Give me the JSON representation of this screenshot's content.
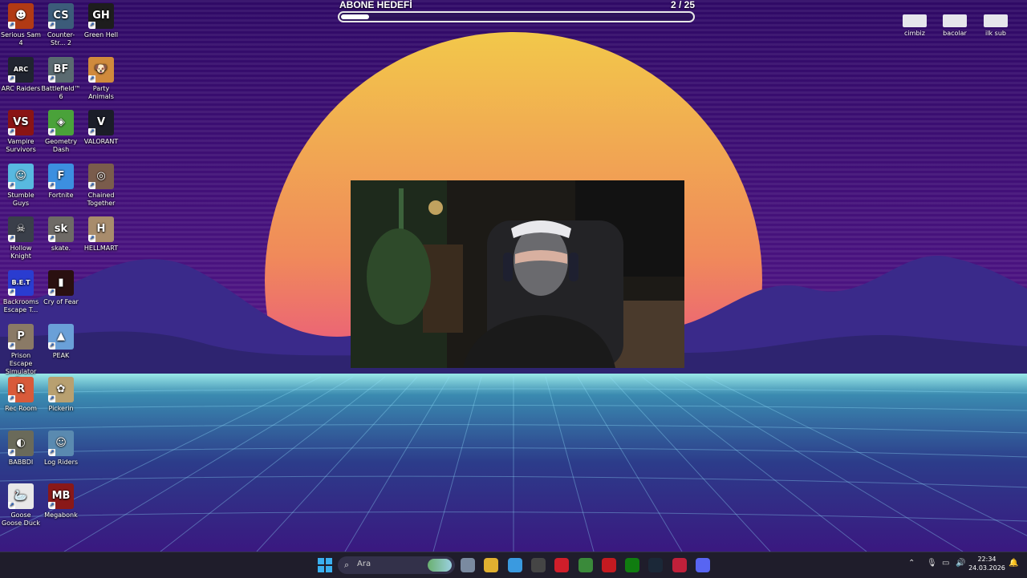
{
  "stream_overlay": {
    "goal_title": "ABONE HEDEFİ",
    "goal_count": "2  / 25",
    "goal_current": 2,
    "goal_target": 25
  },
  "top_right_icons": [
    {
      "name": "cimbiz",
      "label": "cimbiz"
    },
    {
      "name": "bacolar",
      "label": "bacolar"
    },
    {
      "name": "ilk-sub",
      "label": "ilk sub"
    }
  ],
  "desktop_icons": [
    {
      "label": "Serious Sam 4",
      "color": "#b13a14",
      "glyph": "☻"
    },
    {
      "label": "Counter-Str... 2",
      "color": "#3c5c7a",
      "glyph": "CS"
    },
    {
      "label": "Green Hell",
      "color": "#1d1d1d",
      "glyph": "GH"
    },
    {
      "label": "ARC Raiders",
      "color": "#202430",
      "glyph": "ARC"
    },
    {
      "label": "Battlefield™ 6",
      "color": "#5a6a70",
      "glyph": "BF"
    },
    {
      "label": "Party Animals",
      "color": "#d08a3c",
      "glyph": "🐶"
    },
    {
      "label": "Vampire Survivors",
      "color": "#8a1414",
      "glyph": "VS"
    },
    {
      "label": "Geometry Dash",
      "color": "#4aa23a",
      "glyph": "◈"
    },
    {
      "label": "VALORANT",
      "color": "#1b1d28",
      "glyph": "V"
    },
    {
      "label": "Stumble Guys",
      "color": "#58b9e0",
      "glyph": "☺"
    },
    {
      "label": "Fortnite",
      "color": "#3c8fe0",
      "glyph": "F"
    },
    {
      "label": "Chained Together",
      "color": "#7a5c4c",
      "glyph": "◎"
    },
    {
      "label": "Hollow Knight",
      "color": "#3a3f4a",
      "glyph": "☠"
    },
    {
      "label": "skate.",
      "color": "#6e6a66",
      "glyph": "sk"
    },
    {
      "label": "HELLMART",
      "color": "#a88c6c",
      "glyph": "H"
    },
    {
      "label": "Backrooms Escape T...",
      "color": "#2a3cd0",
      "glyph": "B.E.T"
    },
    {
      "label": "Cry of Fear",
      "color": "#2a1010",
      "glyph": "▮"
    },
    {
      "label": "",
      "color": "",
      "glyph": ""
    },
    {
      "label": "Prison Escape Simulator D...",
      "color": "#8a7a66",
      "glyph": "P"
    },
    {
      "label": "PEAK",
      "color": "#6aa0d8",
      "glyph": "▲"
    },
    {
      "label": "",
      "color": "",
      "glyph": ""
    },
    {
      "label": "Rec Room",
      "color": "#d85a3a",
      "glyph": "R"
    },
    {
      "label": "Pickerin",
      "color": "#b8a070",
      "glyph": "✿"
    },
    {
      "label": "",
      "color": "",
      "glyph": ""
    },
    {
      "label": "BABBDI",
      "color": "#6a6a5a",
      "glyph": "◐"
    },
    {
      "label": "Log Riders",
      "color": "#5a8ab0",
      "glyph": "☺"
    },
    {
      "label": "",
      "color": "",
      "glyph": ""
    },
    {
      "label": "Goose Goose Duck",
      "color": "#e8e8e8",
      "glyph": "🦢"
    },
    {
      "label": "Megabonk",
      "color": "#8a1818",
      "glyph": "MB"
    }
  ],
  "taskbar": {
    "search_placeholder": "Ara",
    "apps": [
      {
        "name": "settings",
        "color": "#7a8aa0"
      },
      {
        "name": "file-explorer",
        "color": "#e0b030"
      },
      {
        "name": "chrome",
        "color": "#3a9ae0"
      },
      {
        "name": "obs",
        "color": "#454545"
      },
      {
        "name": "opera",
        "color": "#d01e2a"
      },
      {
        "name": "xbox-app",
        "color": "#3a8a3a"
      },
      {
        "name": "amd-software",
        "color": "#c41a20"
      },
      {
        "name": "xbox",
        "color": "#107c10"
      },
      {
        "name": "steam",
        "color": "#1b2838"
      },
      {
        "name": "opera-gx",
        "color": "#c0203a"
      },
      {
        "name": "discord",
        "color": "#5865f2"
      }
    ],
    "time": "22:34",
    "date": "24.03.2026"
  }
}
